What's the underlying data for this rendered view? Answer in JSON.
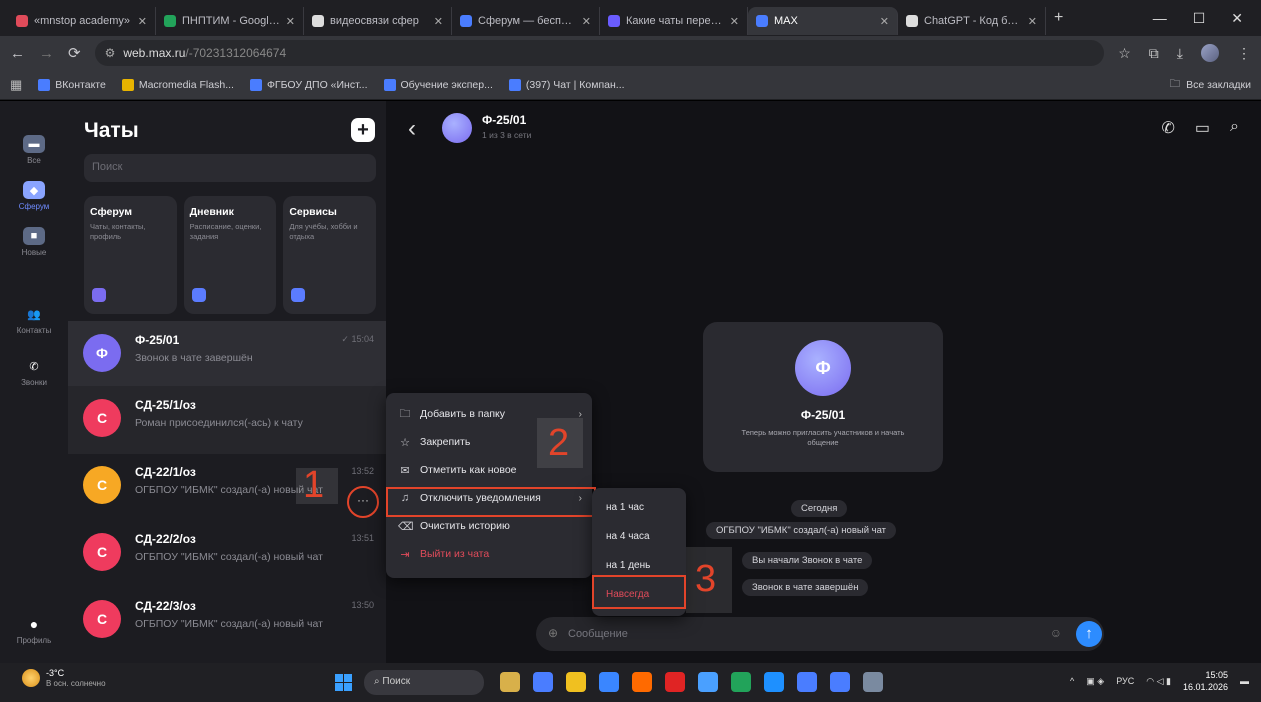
{
  "browser": {
    "tabs": [
      {
        "title": "«mnstop academy»",
        "color": "#e04b5a"
      },
      {
        "title": "ПНПТИМ - Google Та",
        "color": "#22a35a"
      },
      {
        "title": "видеосвязи сфер",
        "color": "#dddddd"
      },
      {
        "title": "Сферум — бесплат",
        "color": "#4a7dff"
      },
      {
        "title": "Какие чаты перенес",
        "color": "#6a5cff"
      },
      {
        "title": "MAX",
        "color": "#4a7dff",
        "active": true
      },
      {
        "title": "ChatGPT - Код будут",
        "color": "#dddddd"
      }
    ],
    "new_tab": "+",
    "window_controls": [
      "—",
      "☐",
      "✕"
    ],
    "url": "web.max.ru",
    "url_path": "/-70231312064674",
    "bookmarks": [
      {
        "label": "ВКонтакте",
        "color": "#4a7dff"
      },
      {
        "label": "Macromedia Flash...",
        "color": "#e8b400"
      },
      {
        "label": "ФГБОУ ДПО «Инст...",
        "color": "#4a7dff"
      },
      {
        "label": "Обучение экспер...",
        "color": "#4a7dff"
      },
      {
        "label": "(397) Чат | Компан...",
        "color": "#4a7dff"
      }
    ],
    "all_bookmarks": "Все закладки"
  },
  "rail": {
    "items": [
      {
        "label": "Все",
        "icon": "chat-icon"
      },
      {
        "label": "Сферум",
        "icon": "sferum-icon",
        "active": true
      },
      {
        "label": "Новые",
        "icon": "new-icon"
      },
      {
        "label": "Контакты",
        "icon": "contacts-icon"
      },
      {
        "label": "Звонки",
        "icon": "phone-icon"
      },
      {
        "label": "Профиль",
        "icon": "profile-icon"
      }
    ]
  },
  "chatlist": {
    "title": "Чаты",
    "plus": "+",
    "search_placeholder": "Поиск",
    "folders": [
      {
        "name": "Сферум",
        "desc": "Чаты, контакты, профиль",
        "color": "#7b6cf0"
      },
      {
        "name": "Дневник",
        "desc": "Расписание, оценки, задания",
        "color": "#5b7cff"
      },
      {
        "name": "Сервисы",
        "desc": "Для учёбы, хобби и отдыха",
        "color": "#5b7cff"
      }
    ],
    "chats": [
      {
        "name": "Ф-25/01",
        "msg": "Звонок в чате завершён",
        "time": "✓ 15:04",
        "avatar": "Ф",
        "color": "#7b6cf0",
        "state": "sel"
      },
      {
        "name": "СД-25/1/оз",
        "msg": "Роман присоединился(-ась) к чату",
        "time": "",
        "avatar": "С",
        "color": "#ef3b5e",
        "state": "hover"
      },
      {
        "name": "СД-22/1/оз",
        "msg": "ОГБПОУ \"ИБМК\" создал(-а) новый чат",
        "time": "13:52",
        "avatar": "С",
        "color": "#f7a824",
        "state": ""
      },
      {
        "name": "СД-22/2/оз",
        "msg": "ОГБПОУ \"ИБМК\" создал(-а) новый чат",
        "time": "13:51",
        "avatar": "С",
        "color": "#ef3b5e",
        "state": ""
      },
      {
        "name": "СД-22/3/оз",
        "msg": "ОГБПОУ \"ИБМК\" создал(-а) новый чат",
        "time": "13:50",
        "avatar": "С",
        "color": "#ef3b5e",
        "state": ""
      }
    ]
  },
  "chat": {
    "name": "Ф-25/01",
    "subtitle": "1 из 3 в сети",
    "avatar": "Ф",
    "info_name": "Ф-25/01",
    "info_desc": "Теперь можно пригласить участников и начать общение",
    "system_messages": [
      "Сегодня",
      "ОГБПОУ \"ИБМК\" создал(-а) новый чат",
      "Вы начали Звонок в чате",
      "Звонок в чате завершён"
    ],
    "composer_placeholder": "Сообщение"
  },
  "context_menu": {
    "items": [
      {
        "label": "Добавить в папку",
        "icon": "folder-icon",
        "arrow": "›"
      },
      {
        "label": "Закрепить",
        "icon": "pin-icon"
      },
      {
        "label": "Отметить как новое",
        "icon": "mark-icon"
      },
      {
        "label": "Отключить уведомления",
        "icon": "bell-off-icon",
        "arrow": "›"
      },
      {
        "label": "Очистить историю",
        "icon": "broom-icon"
      },
      {
        "label": "Выйти из чата",
        "icon": "exit-icon",
        "danger": true
      }
    ],
    "submenu": [
      {
        "label": "на 1 час"
      },
      {
        "label": "на 4 часа"
      },
      {
        "label": "на 1 день"
      },
      {
        "label": "Навсегда",
        "danger": true
      }
    ]
  },
  "annotations": {
    "n1": "1",
    "n2": "2",
    "n3": "3"
  },
  "taskbar": {
    "temp": "-3°C",
    "weather_desc": "В осн. солнечно",
    "search": "Поиск",
    "lang": "РУС",
    "time": "15:05",
    "date": "16.01.2026",
    "app_colors": [
      "#d8b04a",
      "#4a7dff",
      "#f0c020",
      "#3a86ff",
      "#ff6a00",
      "#e02424",
      "#4aa0ff",
      "#22a35a",
      "#1e90ff",
      "#4a7dff",
      "#4a7dff",
      "#7a8aa0"
    ]
  }
}
